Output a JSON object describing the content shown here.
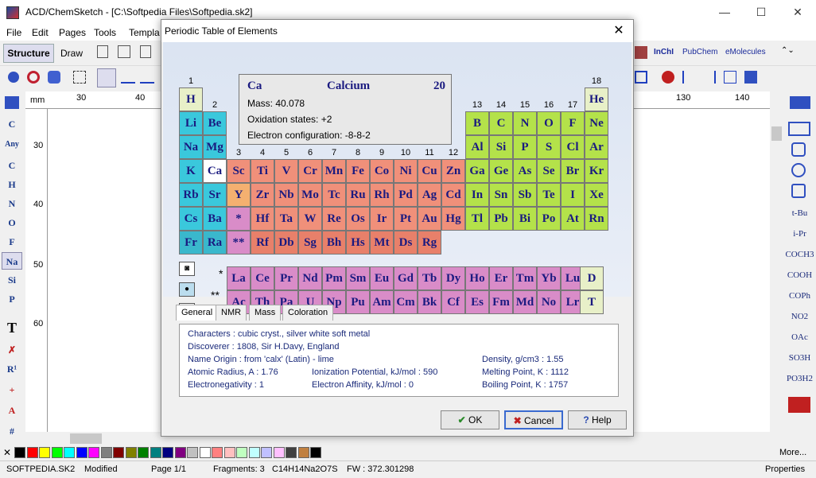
{
  "app": {
    "title": "ACD/ChemSketch - [C:\\Softpedia Files\\Softpedia.sk2]",
    "window_controls": {
      "minimize": "—",
      "maximize": "☐",
      "close": "✕"
    }
  },
  "menu": [
    "File",
    "Edit",
    "Pages",
    "Tools",
    "Templa"
  ],
  "modes": {
    "structure": "Structure",
    "draw": "Draw"
  },
  "toolbar_right": {
    "inchi": "InChI",
    "pubchem": "PubChem",
    "emolecules": "eMolecules"
  },
  "left_tools": [
    "Any",
    "C",
    "H",
    "N",
    "O",
    "F",
    "Na",
    "Si",
    "P",
    "T",
    "R¹",
    "+",
    "#"
  ],
  "right_tools": [
    "t-Bu",
    "i-Pr",
    "COCH3",
    "COOH",
    "COPh",
    "NO2",
    "OAc",
    "SO3H",
    "PO3H2"
  ],
  "ruler": {
    "unit": "mm",
    "top_marks": [
      "30",
      "40",
      "130",
      "140"
    ],
    "left_marks": [
      "30",
      "40",
      "50",
      "60"
    ]
  },
  "palette_colors": [
    "#000000",
    "#ff0000",
    "#ffff00",
    "#00ff00",
    "#00ffff",
    "#0000ff",
    "#ff00ff",
    "#808080",
    "#800000",
    "#808000",
    "#008000",
    "#008080",
    "#000080",
    "#800080",
    "#c0c0c0",
    "#ffffff",
    "#ff8080",
    "#ffc0c0",
    "#c0ffc0",
    "#c0ffff",
    "#c0c0ff",
    "#ffc0ff",
    "#404040",
    "#c08040",
    "#000000"
  ],
  "more": "More...",
  "status": {
    "file": "SOFTPEDIA.SK2",
    "modified": "Modified",
    "page": "Page 1/1",
    "fragments": "Fragments: 3",
    "formula": "C14H14Na2O7S",
    "fw": "FW : 372.301298",
    "properties": "Properties"
  },
  "dialog": {
    "title": "Periodic Table of Elements",
    "selected": {
      "symbol": "Ca",
      "name": "Calcium",
      "number": "20",
      "mass": "Mass: 40.078",
      "oxidation": "Oxidation states: +2",
      "config": "Electron configuration: -8-8-2"
    },
    "group_numbers": [
      "1",
      "2",
      "3",
      "4",
      "5",
      "6",
      "7",
      "8",
      "9",
      "10",
      "11",
      "12",
      "13",
      "14",
      "15",
      "16",
      "17",
      "18"
    ],
    "colors": {
      "alkali": "#3ac8dc",
      "alkaline": "#3ac8dc",
      "transition": "#f0907a",
      "post": "#b4e24a",
      "nonmetal": "#b4e24a",
      "noble": "#e8f0c8",
      "hydrogen": "#e8f0c8",
      "lanth": "#d98cc8",
      "ds": "#e87060"
    },
    "series_labels": {
      "lanthanides": "*",
      "actinides": "**"
    },
    "lanthanides": [
      "La",
      "Ce",
      "Pr",
      "Nd",
      "Pm",
      "Sm",
      "Eu",
      "Gd",
      "Tb",
      "Dy",
      "Ho",
      "Er",
      "Tm",
      "Yb",
      "Lu"
    ],
    "actinides": [
      "Ac",
      "Th",
      "Pa",
      "U",
      "Np",
      "Pu",
      "Am",
      "Cm",
      "Bk",
      "Cf",
      "Es",
      "Fm",
      "Md",
      "No",
      "Lr"
    ],
    "isotopes": [
      "D",
      "T"
    ],
    "tabs": [
      "General",
      "NMR",
      "Mass",
      "Coloration"
    ],
    "props": {
      "characters": "Characters :   cubic cryst., silver white soft metal",
      "discoverer": "Discoverer :   1808, Sir H.Davy, England",
      "name_origin": "Name Origin : from 'calx' (Latin) - lime",
      "density": "Density, g/cm3 :  1.55",
      "radius": "Atomic Radius, A :  1.76",
      "ionization": "Ionization Potential, kJ/mol :  590",
      "melting": "Melting Point, K :  1112",
      "electroneg": "Electronegativity :  1",
      "affinity": "Electron Affinity, kJ/mol :      0",
      "boiling": "Boiling Point, K :   1757"
    },
    "buttons": {
      "ok": "OK",
      "cancel": "Cancel",
      "help": "Help"
    }
  }
}
